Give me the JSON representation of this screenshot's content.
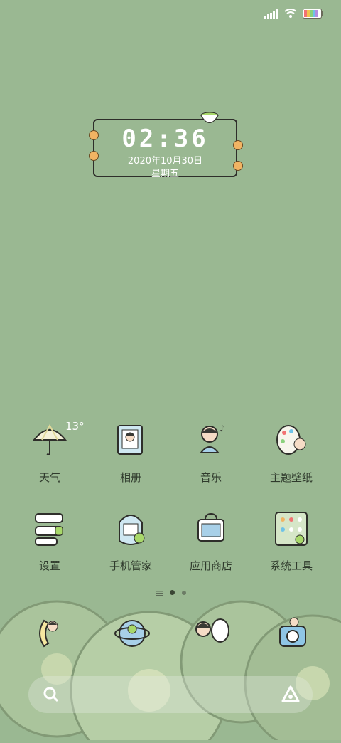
{
  "status_bar": {
    "signal_icon": "signal-icon",
    "wifi_icon": "wifi-icon",
    "battery_icon": "battery-icon"
  },
  "clock": {
    "time": "02:36",
    "date": "2020年10月30日",
    "weekday": "星期五"
  },
  "weather": {
    "temperature": "13°"
  },
  "apps": [
    {
      "label": "天气",
      "icon": "umbrella-icon"
    },
    {
      "label": "相册",
      "icon": "photo-album-icon"
    },
    {
      "label": "音乐",
      "icon": "music-icon"
    },
    {
      "label": "主题壁纸",
      "icon": "palette-icon"
    },
    {
      "label": "设置",
      "icon": "settings-icon"
    },
    {
      "label": "手机管家",
      "icon": "phone-manager-icon"
    },
    {
      "label": "应用商店",
      "icon": "app-store-icon"
    },
    {
      "label": "系统工具",
      "icon": "system-tools-icon"
    }
  ],
  "page_indicator": {
    "pages": 3,
    "active": 1
  },
  "dock": [
    {
      "icon": "phone-icon"
    },
    {
      "icon": "browser-icon"
    },
    {
      "icon": "messages-icon"
    },
    {
      "icon": "camera-icon"
    }
  ],
  "search": {
    "search_icon": "search-icon",
    "assistant_icon": "assistant-icon"
  },
  "colors": {
    "background": "#9ab892",
    "text": "#2f3a2c",
    "accent": "#f1b463"
  }
}
